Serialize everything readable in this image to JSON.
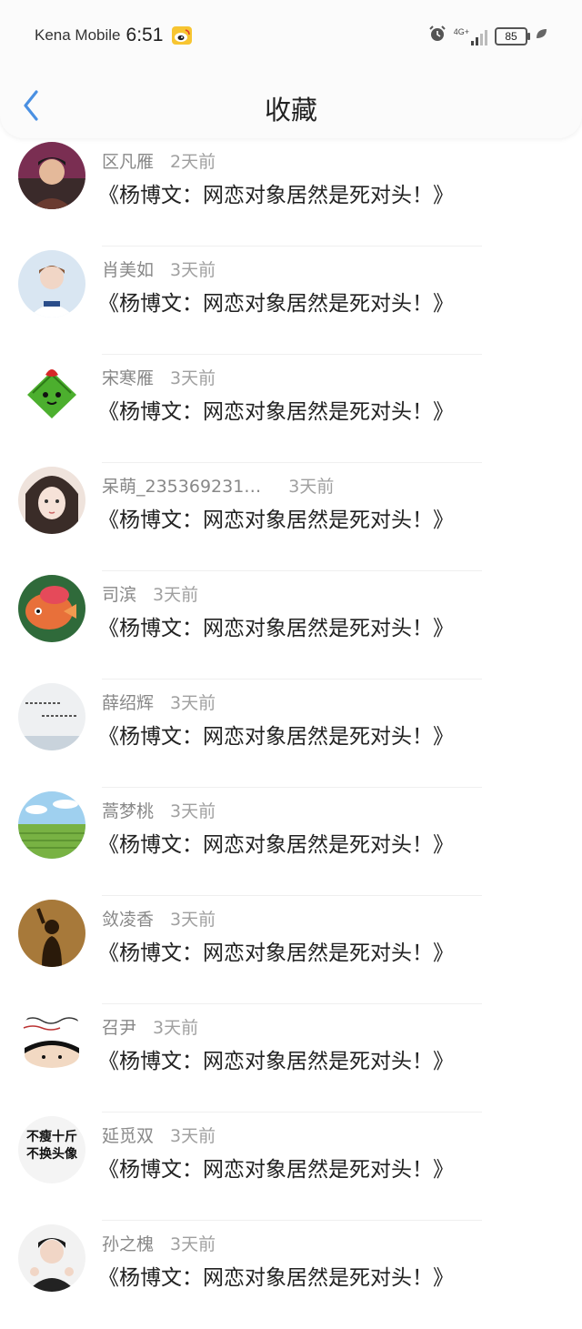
{
  "status_bar": {
    "carrier": "Kena Mobile",
    "time": "6:51",
    "network": "4G+",
    "battery": "85"
  },
  "header": {
    "title": "收藏"
  },
  "items": [
    {
      "name": "区凡雁",
      "time": "2天前",
      "title": "《杨博文：网恋对象居然是死对头！》"
    },
    {
      "name": "肖美如",
      "time": "3天前",
      "title": "《杨博文：网恋对象居然是死对头！》"
    },
    {
      "name": "宋寒雁",
      "time": "3天前",
      "title": "《杨博文：网恋对象居然是死对头！》"
    },
    {
      "name": "呆萌_235369231…",
      "time": "3天前",
      "title": "《杨博文：网恋对象居然是死对头！》"
    },
    {
      "name": "司滨",
      "time": "3天前",
      "title": "《杨博文：网恋对象居然是死对头！》"
    },
    {
      "name": "薛绍辉",
      "time": "3天前",
      "title": "《杨博文：网恋对象居然是死对头！》"
    },
    {
      "name": "蒿梦桃",
      "time": "3天前",
      "title": "《杨博文：网恋对象居然是死对头！》"
    },
    {
      "name": "敛凌香",
      "time": "3天前",
      "title": "《杨博文：网恋对象居然是死对头！》"
    },
    {
      "name": "召尹",
      "time": "3天前",
      "title": "《杨博文：网恋对象居然是死对头！》"
    },
    {
      "name": "延觅双",
      "time": "3天前",
      "title": "《杨博文：网恋对象居然是死对头！》"
    },
    {
      "name": "孙之槐",
      "time": "3天前",
      "title": "《杨博文：网恋对象居然是死对头！》"
    }
  ],
  "avatar_texts": {
    "item_10": [
      "不瘦十斤",
      "不换头像"
    ]
  }
}
